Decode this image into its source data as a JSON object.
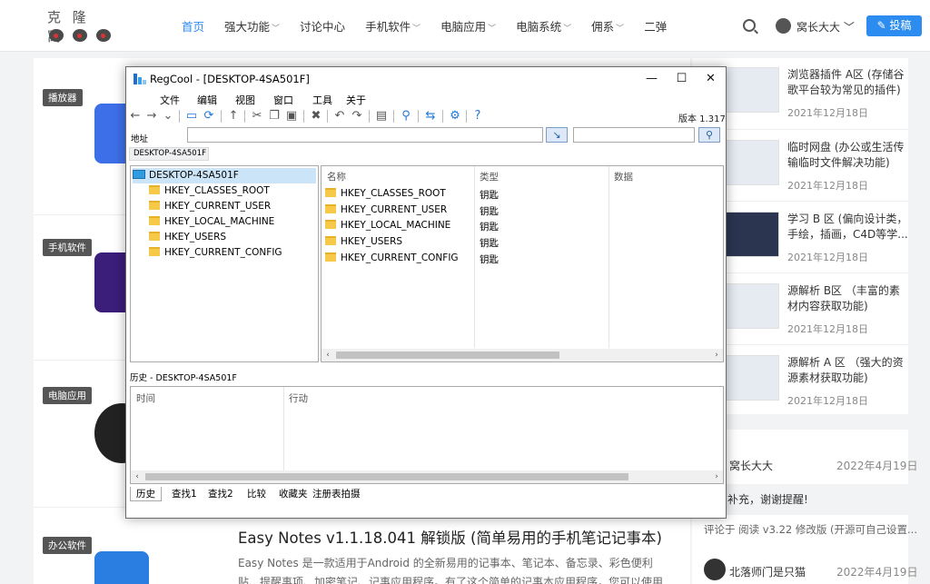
{
  "site": {
    "logo_text": "克 隆 窝",
    "nav": [
      {
        "label": "首页",
        "active": true,
        "caret": false
      },
      {
        "label": "强大功能",
        "caret": true
      },
      {
        "label": "讨论中心",
        "caret": false
      },
      {
        "label": "手机软件",
        "caret": true
      },
      {
        "label": "电脑应用",
        "caret": true
      },
      {
        "label": "电脑系统",
        "caret": true
      },
      {
        "label": "佣系",
        "caret": true
      },
      {
        "label": "二弹",
        "caret": false
      }
    ],
    "user_name": "窝长大大 ﹀",
    "post_button": "✎ 投稿",
    "accent": "#2d8cf0"
  },
  "articles": {
    "tags": [
      "播放器",
      "手机软件",
      "电脑应用",
      "办公软件"
    ],
    "featured_title": "Easy Notes v1.1.18.041 解锁版 (简单易用的手机笔记记事本)",
    "featured_desc": "Easy Notes 是一款适用于Android 的全新易用的记事本、笔记本、备忘录、彩色便利贴、提醒事项、加密笔记、记事应用程序。有了这个简单的记事本应用程序，您可以使用彩色背景..."
  },
  "sidebar": {
    "posts": [
      {
        "title": "浏览器插件 A区 (存储谷歌平台较为常见的插件)",
        "date": "2021年12月18日"
      },
      {
        "title": "临时网盘 (办公或生活传输临时文件解决功能)",
        "date": "2021年12月18日"
      },
      {
        "title": "学习 B 区 (偏向设计类，手绘，插画，C4D等学...",
        "date": "2021年12月18日"
      },
      {
        "title": "源解析 B区 （丰富的素材内容获取功能)",
        "date": "2021年12月18日"
      },
      {
        "title": "源解析 A 区 （强大的资源素材获取功能)",
        "date": "2021年12月18日"
      }
    ],
    "comments": [
      {
        "author": "窝长大大",
        "date": "2022年4月19日",
        "text": "补充，谢谢提醒!",
        "ref": "评论于 阅读 v3.22 修改版 (开源可自己设置..."
      },
      {
        "author": "北落师门是只猫",
        "date": "2022年4月19日"
      }
    ]
  },
  "regcool": {
    "title": "RegCool - [DESKTOP-4SA501F]",
    "controls": {
      "minimize": "—",
      "maximize": "☐",
      "close": "✕"
    },
    "menu": [
      "文件",
      "编辑",
      "视图",
      "窗口",
      "工具",
      "关于"
    ],
    "version": "版本 1.317",
    "address_label": "地址",
    "path_tab": "DESKTOP-4SA501F",
    "tree_root": "DESKTOP-4SA501F",
    "hives": [
      "HKEY_CLASSES_ROOT",
      "HKEY_CURRENT_USER",
      "HKEY_LOCAL_MACHINE",
      "HKEY_USERS",
      "HKEY_CURRENT_CONFIG"
    ],
    "columns": {
      "name": "名称",
      "type": "类型",
      "data": "数据"
    },
    "key_type": "钥匙",
    "history_label": "历史 - DESKTOP-4SA501F",
    "history_columns": {
      "time": "时间",
      "action": "行动"
    },
    "bottom_tabs": [
      "历史",
      "查找1",
      "查找2",
      "比较",
      "收藏夹",
      "注册表拍摄"
    ]
  }
}
